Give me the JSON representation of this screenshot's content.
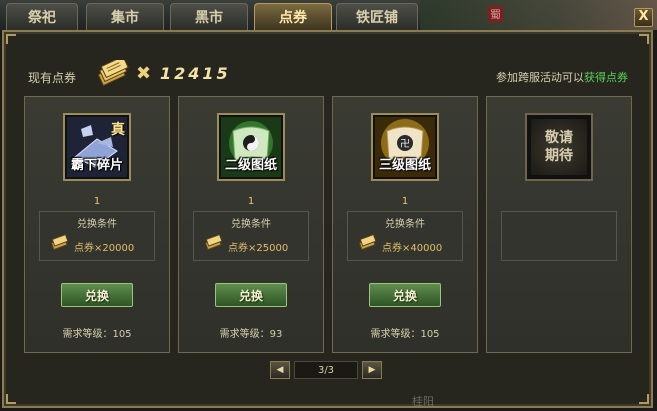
{
  "tabs": [
    {
      "label": "祭祀",
      "active": false
    },
    {
      "label": "集市",
      "active": false
    },
    {
      "label": "黑市",
      "active": false
    },
    {
      "label": "点券",
      "active": true
    },
    {
      "label": "铁匠铺",
      "active": false
    }
  ],
  "close_label": "X",
  "map_tag": "蜀",
  "header": {
    "current_label": "现有点券",
    "multiplier": "✖",
    "points": "12415",
    "promo_text": "参加跨服活动可以",
    "promo_link": "获得点券"
  },
  "cards": [
    {
      "caption": "霸下碎片",
      "tag": "真",
      "qty": "1",
      "cond_title": "兑换条件",
      "cond_text": "点券×20000",
      "button": "兑换",
      "req": "需求等级：105",
      "theme": "#6a7ea8"
    },
    {
      "caption": "二级图纸",
      "tag": "",
      "qty": "1",
      "cond_title": "兑换条件",
      "cond_text": "点券×25000",
      "button": "兑换",
      "req": "需求等级：93",
      "theme": "#3f8d3a"
    },
    {
      "caption": "三级图纸",
      "tag": "",
      "qty": "1",
      "cond_title": "兑换条件",
      "cond_text": "点券×40000",
      "button": "兑换",
      "req": "需求等级：105",
      "theme": "#b2871f"
    }
  ],
  "coming_soon": "敬请\n期待",
  "pager": {
    "prev": "◀",
    "text": "3/3",
    "next": "▶"
  },
  "bottom_label": "桂阳"
}
